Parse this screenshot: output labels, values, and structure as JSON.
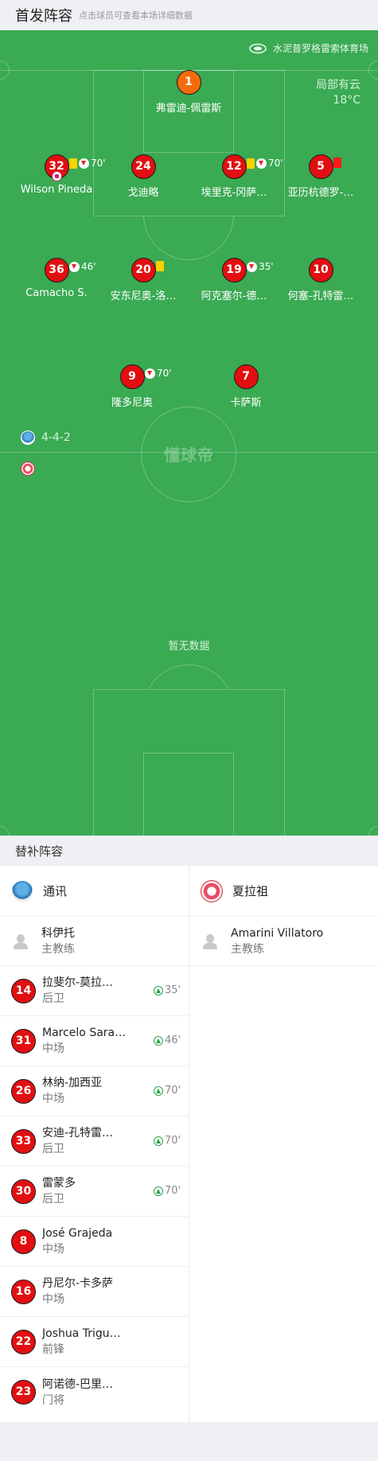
{
  "header": {
    "title": "首发阵容",
    "hint": "点击球员可查看本场详细数据"
  },
  "pitch": {
    "venue": "水泥普罗格雷索体育场",
    "weather": "局部有云",
    "temperature": "18°C",
    "formation": "4-4-2",
    "watermark": "懂球帝",
    "no_data": "暂无数据",
    "players": [
      {
        "number": "1",
        "name": "弗雷迪-佩雷斯",
        "goalkeeper": true
      },
      {
        "number": "32",
        "name": "Wilson Pineda",
        "yellow": true,
        "sub_out": true,
        "minute": "70'",
        "goal": true
      },
      {
        "number": "24",
        "name": "戈迪略"
      },
      {
        "number": "12",
        "name": "埃里克-冈萨…",
        "yellow": true,
        "sub_out": true,
        "minute": "70'"
      },
      {
        "number": "5",
        "name": "亚历杭德罗-…",
        "red": true
      },
      {
        "number": "36",
        "name": "Camacho S.",
        "sub_out": true,
        "minute": "46'"
      },
      {
        "number": "20",
        "name": "安东尼奥-洛…",
        "yellow": true
      },
      {
        "number": "19",
        "name": "阿克塞尔-德…",
        "sub_out": true,
        "minute": "35'"
      },
      {
        "number": "10",
        "name": "何塞-孔特雷…"
      },
      {
        "number": "9",
        "name": "隆多尼奥",
        "sub_out": true,
        "minute": "70'"
      },
      {
        "number": "7",
        "name": "卡萨斯"
      }
    ]
  },
  "subs": {
    "title": "替补阵容",
    "home": {
      "team_name": "通讯",
      "coach": {
        "name": "科伊托",
        "role": "主教练"
      },
      "players": [
        {
          "number": "14",
          "name": "拉斐尔-莫拉…",
          "position": "后卫",
          "in_minute": "35'"
        },
        {
          "number": "31",
          "name": "Marcelo Sarai…",
          "position": "中场",
          "in_minute": "46'"
        },
        {
          "number": "26",
          "name": "林纳-加西亚",
          "position": "中场",
          "in_minute": "70'"
        },
        {
          "number": "33",
          "name": "安迪-孔特雷…",
          "position": "后卫",
          "in_minute": "70'"
        },
        {
          "number": "30",
          "name": "雷蒙多",
          "position": "后卫",
          "in_minute": "70'"
        },
        {
          "number": "8",
          "name": "José Grajeda",
          "position": "中场"
        },
        {
          "number": "16",
          "name": "丹尼尔-卡多萨",
          "position": "中场"
        },
        {
          "number": "22",
          "name": "Joshua Trigu…",
          "position": "前锋"
        },
        {
          "number": "23",
          "name": "阿诺德-巴里…",
          "position": "门将"
        }
      ]
    },
    "away": {
      "team_name": "夏拉祖",
      "coach": {
        "name": "Amarini Villatoro",
        "role": "主教练"
      }
    }
  },
  "colors": {
    "pitch": "#3aaa53",
    "player_badge": "#e10f12",
    "goalkeeper_badge": "#f46b0d",
    "sub_in": "#2aa34a"
  }
}
